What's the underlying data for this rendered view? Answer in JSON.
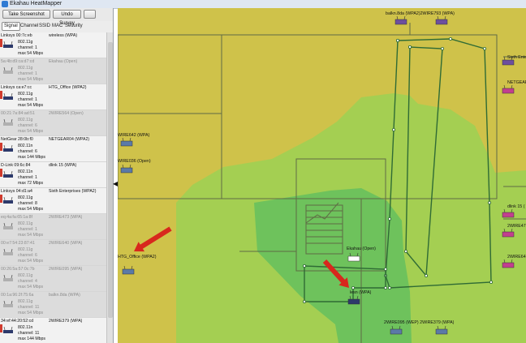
{
  "window": {
    "title": "Ekahau HeatMapper"
  },
  "toolbar": {
    "screenshot_label": "Take Screenshot",
    "undo_label": "Undo Survey",
    "extra_label": ""
  },
  "tabs": [
    "Signal",
    "Channel",
    "SSID",
    "MAC",
    "Security"
  ],
  "active_tab": "Signal",
  "ap_list": [
    {
      "header": "Linksys 00:7c:eb",
      "network": "wireless (WPA)",
      "lines": [
        "802.11g",
        "channel: 1",
        "max 54 Mbps"
      ],
      "dim": false
    },
    {
      "header": "5a:4b:d9:ca:d7:cd",
      "network": "Ekahau (Open)",
      "lines": [
        "802.11g",
        "channel: 1",
        "max 54 Mbps"
      ],
      "dim": true
    },
    {
      "header": "Linksys ca:e7:cc",
      "network": "HTG_Office (WPA2)",
      "lines": [
        "802.11g",
        "channel: 1",
        "max 54 Mbps"
      ],
      "dim": false
    },
    {
      "header": "00:21:7a:84:ad:51",
      "network": "2WIRE564 (Open)",
      "lines": [
        "802.11g",
        "channel: 6",
        "max 54 Mbps"
      ],
      "dim": true
    },
    {
      "header": "NetGear 28:0b:f0",
      "network": "NETGEAR04 (WPA2)",
      "lines": [
        "802.11n",
        "channel: 6",
        "max 144 Mbps"
      ],
      "dim": false
    },
    {
      "header": "D-Link 09:6c:84",
      "network": "dlink 15 (WPA)",
      "lines": [
        "802.11n",
        "channel: 1",
        "max 72 Mbps"
      ],
      "dim": false
    },
    {
      "header": "Linksys 04:d1:a4",
      "network": "Sixth Enterprises (WPA2)",
      "lines": [
        "802.11g",
        "channel: 8",
        "max 54 Mbps"
      ],
      "dim": false
    },
    {
      "header": "eq:4a:fa:65:1a:8f",
      "network": "2WIRE473 (WPA)",
      "lines": [
        "802.11g",
        "channel: 1",
        "max 54 Mbps"
      ],
      "dim": true
    },
    {
      "header": "00:e7:54:23:87:41",
      "network": "2WIRE640 (WPA)",
      "lines": [
        "802.11g",
        "channel: 6",
        "max 54 Mbps"
      ],
      "dim": true
    },
    {
      "header": "00:26:5a:57:0c:7b",
      "network": "2WIRE095 (WPA)",
      "lines": [
        "802.11g",
        "channel: 4",
        "max 54 Mbps"
      ],
      "dim": true
    },
    {
      "header": "00:1a:96:2f:75:6a",
      "network": "balkn.8da (WPA)",
      "lines": [
        "802.11g",
        "channel: 11",
        "max 54 Mbps"
      ],
      "dim": true
    },
    {
      "header": "34:ef:44:20:52:cd",
      "network": "2WIRE379 (WPA)",
      "lines": [
        "802.11n",
        "channel: 11",
        "max 144 Mbps"
      ],
      "dim": false
    }
  ],
  "map_labels": {
    "top_pair": "balkn.8da (WPA2)2WIRE793 (WPA)",
    "right_sixth": "Sixth Enter",
    "right_netgear": "NETGEAR",
    "wire_left1": "WIRE642 (WPA)",
    "wire_left2": "WIRE036 (Open)",
    "htg_office": "HTG_Office (WPA2)",
    "dlink": "dlink 15 (",
    "twowire_r1": "2WIRE47",
    "twowire_r2": "2WIRE64",
    "ekahau_open": "Ekahau (Open)",
    "lsmn": "lesn (WPA)",
    "bottom_pair": "2WIRE095 (WEP) 2WIRE379 (WPA)"
  },
  "colors": {
    "weak": "#cfc24a",
    "medium": "#a4cf52",
    "strong": "#6ec25c",
    "route": "#2f6b35",
    "arrow": "#d8281d"
  }
}
